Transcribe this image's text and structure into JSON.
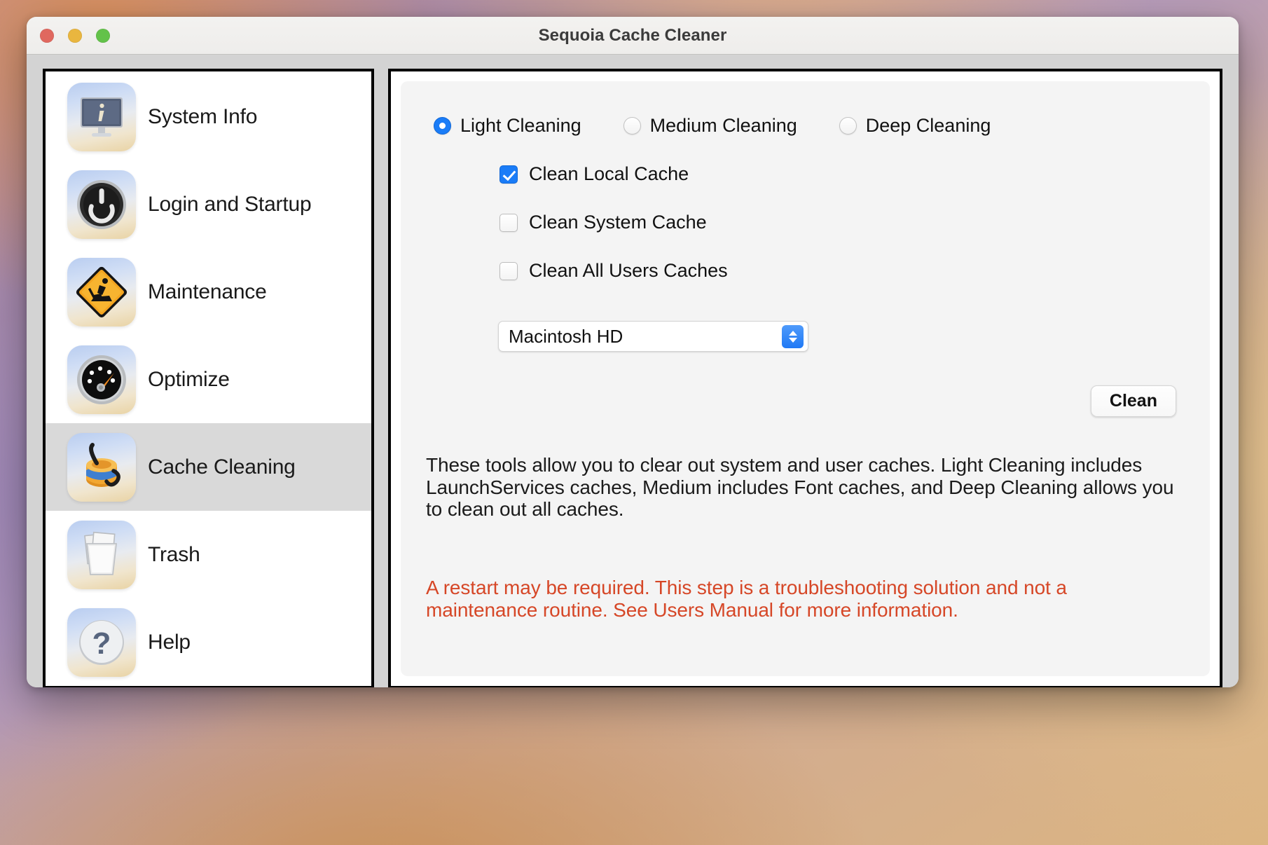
{
  "window": {
    "title": "Sequoia Cache Cleaner",
    "traffic_lights": [
      {
        "name": "close",
        "color": "#e0685f"
      },
      {
        "name": "minimize",
        "color": "#e9b63f"
      },
      {
        "name": "maximize",
        "color": "#63c24a"
      }
    ]
  },
  "sidebar": {
    "items": [
      {
        "label": "System Info",
        "icon": "monitor-info-icon",
        "selected": false
      },
      {
        "label": "Login and Startup",
        "icon": "power-button-icon",
        "selected": false
      },
      {
        "label": "Maintenance",
        "icon": "construction-sign-icon",
        "selected": false
      },
      {
        "label": "Optimize",
        "icon": "speedometer-icon",
        "selected": false
      },
      {
        "label": "Cache Cleaning",
        "icon": "vacuum-cleaner-icon",
        "selected": true
      },
      {
        "label": "Trash",
        "icon": "trash-papers-icon",
        "selected": false
      },
      {
        "label": "Help",
        "icon": "question-mark-icon",
        "selected": false
      }
    ]
  },
  "main": {
    "cleaning_level": {
      "options": [
        {
          "label": "Light Cleaning",
          "selected": true
        },
        {
          "label": "Medium Cleaning",
          "selected": false
        },
        {
          "label": "Deep Cleaning",
          "selected": false
        }
      ]
    },
    "checkboxes": [
      {
        "label": "Clean Local Cache",
        "checked": true
      },
      {
        "label": "Clean System Cache",
        "checked": false
      },
      {
        "label": "Clean All Users Caches",
        "checked": false
      }
    ],
    "volume_popup": {
      "value": "Macintosh HD",
      "options": [
        "Macintosh HD"
      ]
    },
    "clean_button": "Clean",
    "description": "These tools allow you to clear out system and user caches.  Light Cleaning includes LaunchServices caches, Medium includes Font caches, and Deep Cleaning allows you to clean out all caches.",
    "warning": "A restart may be required.  This step is a troubleshooting solution and not a maintenance routine.  See Users Manual for more information.",
    "warning_color": "#d64727",
    "accent_color": "#1a7cf7"
  }
}
